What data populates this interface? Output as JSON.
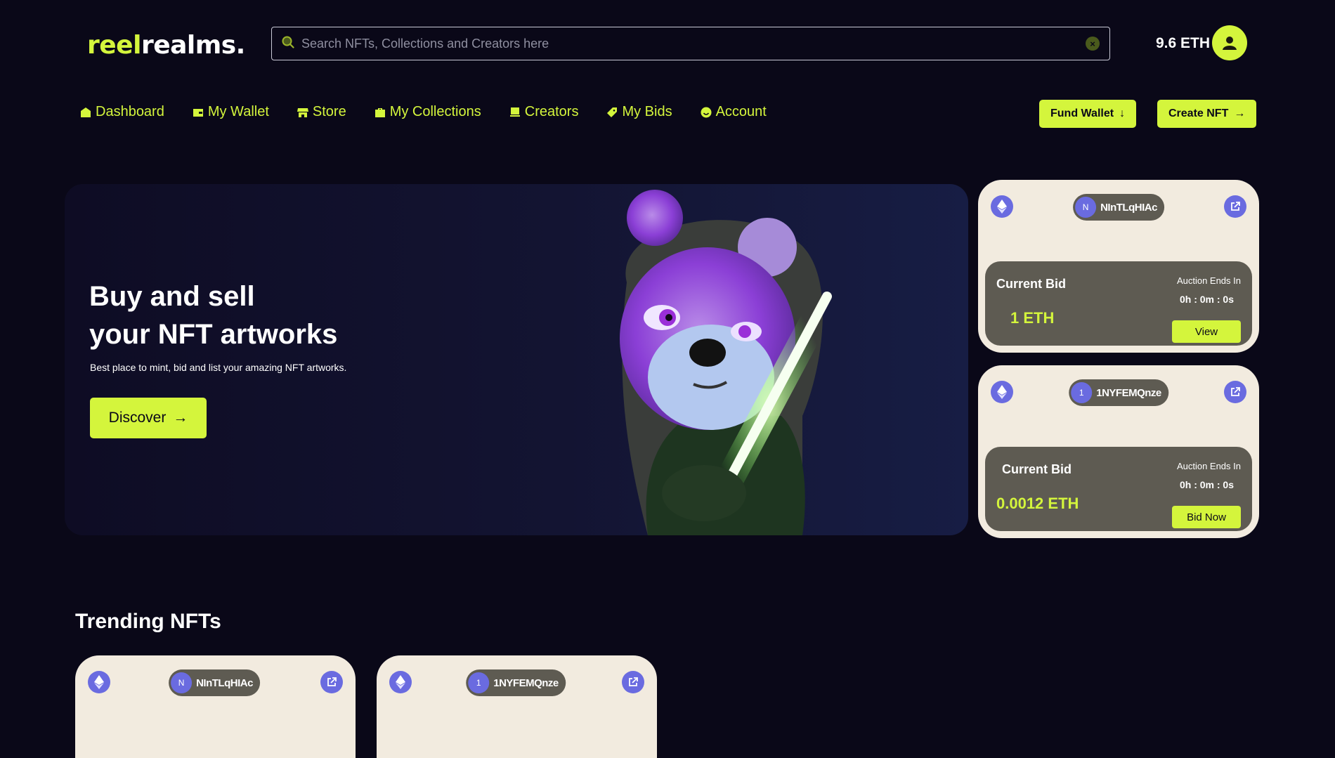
{
  "logo": {
    "part1": "reel",
    "part2": "realms."
  },
  "search": {
    "placeholder": "Search NFTs, Collections and Creators here"
  },
  "header": {
    "balance": "9.6 ETH"
  },
  "nav": {
    "items": [
      {
        "label": "Dashboard",
        "icon": "home-icon"
      },
      {
        "label": "My Wallet",
        "icon": "wallet-icon"
      },
      {
        "label": "Store",
        "icon": "store-icon"
      },
      {
        "label": "My Collections",
        "icon": "briefcase-icon"
      },
      {
        "label": "Creators",
        "icon": "easel-icon"
      },
      {
        "label": "My Bids",
        "icon": "tag-icon"
      },
      {
        "label": "Account",
        "icon": "smile-icon"
      }
    ],
    "fund_wallet": "Fund Wallet",
    "create_nft": "Create NFT"
  },
  "hero": {
    "title_line1": "Buy and sell",
    "title_line2": "your NFT artworks",
    "subtitle": "Best place to mint, bid and list your amazing NFT artworks.",
    "cta": "Discover"
  },
  "auction_cards": [
    {
      "avatar_letter": "N",
      "creator": "NInTLqHIAc",
      "current_bid_label": "Current Bid",
      "amount": "1 ETH",
      "ends_label": "Auction Ends In",
      "timer": "0h : 0m : 0s",
      "action": "View"
    },
    {
      "avatar_letter": "1",
      "creator": "1NYFEMQnze",
      "current_bid_label": "Current Bid",
      "amount": "0.0012 ETH",
      "ends_label": "Auction Ends In",
      "timer": "0h : 0m : 0s",
      "action": "Bid Now"
    }
  ],
  "trending": {
    "title": "Trending NFTs",
    "cards": [
      {
        "avatar_letter": "N",
        "creator": "NInTLqHIAc"
      },
      {
        "avatar_letter": "1",
        "creator": "1NYFEMQnze"
      }
    ]
  },
  "colors": {
    "accent": "#d4f53c",
    "background": "#0a0818",
    "card": "#f2ebdf",
    "chip": "#5e5b52",
    "eth_badge": "#6a6be0"
  }
}
